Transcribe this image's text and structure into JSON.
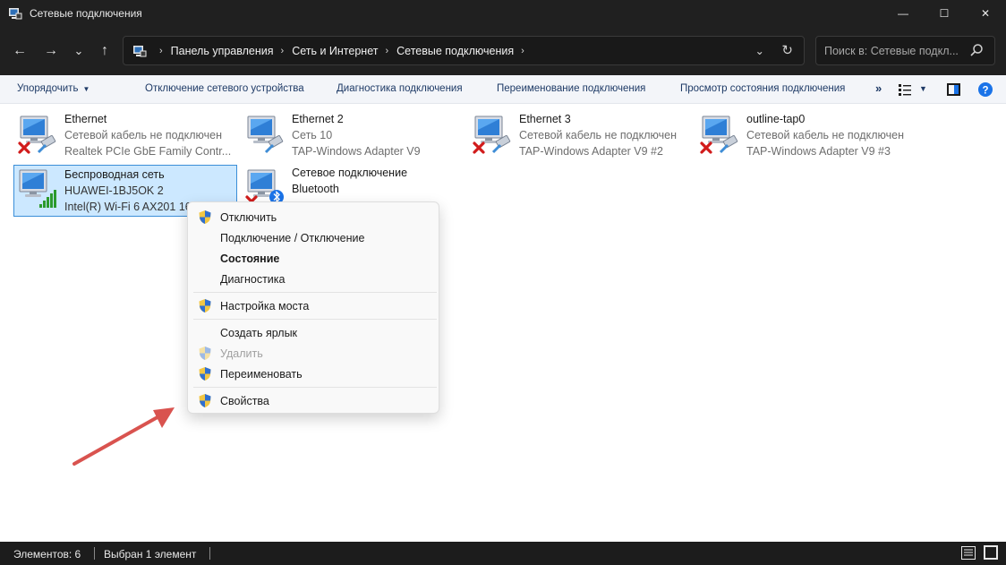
{
  "window": {
    "title": "Сетевые подключения",
    "minimize_glyph": "—",
    "maximize_glyph": "☐",
    "close_glyph": "✕"
  },
  "nav": {
    "back_glyph": "←",
    "forward_glyph": "→",
    "recent_glyph": "⌄",
    "up_glyph": "↑",
    "breadcrumbs": [
      "Панель управления",
      "Сеть и Интернет",
      "Сетевые подключения"
    ],
    "crumb_separator": "›",
    "dropdown_glyph": "⌄",
    "refresh_glyph": "↻",
    "search_placeholder": "Поиск в: Сетевые подкл..."
  },
  "commandbar": {
    "organize": "Упорядочить",
    "organize_caret": "▼",
    "disable_device": "Отключение сетевого устройства",
    "diagnose": "Диагностика подключения",
    "rename": "Переименование подключения",
    "view_status": "Просмотр состояния подключения",
    "more": "»",
    "view_caret": "▼"
  },
  "connections": [
    {
      "name": "Ethernet",
      "status": "Сетевой кабель не подключен",
      "adapter": "Realtek PCIe GbE Family Contr...",
      "icon": "wired-network-icon",
      "state": "disconnected"
    },
    {
      "name": "Ethernet 2",
      "status": "Сеть 10",
      "adapter": "TAP-Windows Adapter V9",
      "icon": "wired-network-icon",
      "state": "connected"
    },
    {
      "name": "Ethernet 3",
      "status": "Сетевой кабель не подключен",
      "adapter": "TAP-Windows Adapter V9 #2",
      "icon": "wired-network-icon",
      "state": "disconnected"
    },
    {
      "name": "outline-tap0",
      "status": "Сетевой кабель не подключен",
      "adapter": "TAP-Windows Adapter V9 #3",
      "icon": "wired-network-icon",
      "state": "disconnected"
    },
    {
      "name": "Беспроводная сеть",
      "status": "HUAWEI-1BJ5OK 2",
      "adapter": "Intel(R) Wi-Fi 6 AX201 16",
      "icon": "wifi-network-icon",
      "state": "selected"
    },
    {
      "name": "Сетевое подключение",
      "status": "Bluetooth",
      "adapter": "",
      "icon": "bluetooth-network-icon",
      "state": "disconnected"
    }
  ],
  "context_menu": {
    "items": [
      {
        "label": "Отключить",
        "shield": true
      },
      {
        "label": "Подключение / Отключение",
        "shield": false
      },
      {
        "label": "Состояние",
        "shield": false,
        "bold": true
      },
      {
        "label": "Диагностика",
        "shield": false
      },
      {
        "label": "Настройка моста",
        "shield": true
      },
      {
        "label": "Создать ярлык",
        "shield": false
      },
      {
        "label": "Удалить",
        "shield": true,
        "disabled": true
      },
      {
        "label": "Переименовать",
        "shield": true
      },
      {
        "label": "Свойства",
        "shield": true
      }
    ]
  },
  "statusbar": {
    "items_count": "Элементов: 6",
    "selected": "Выбран 1 элемент"
  },
  "colors": {
    "accent": "#1a73e8",
    "selection_bg": "#cce8ff",
    "selection_border": "#3b8ed8",
    "annotation_arrow": "#d9534f",
    "dark_chrome": "#202020"
  }
}
